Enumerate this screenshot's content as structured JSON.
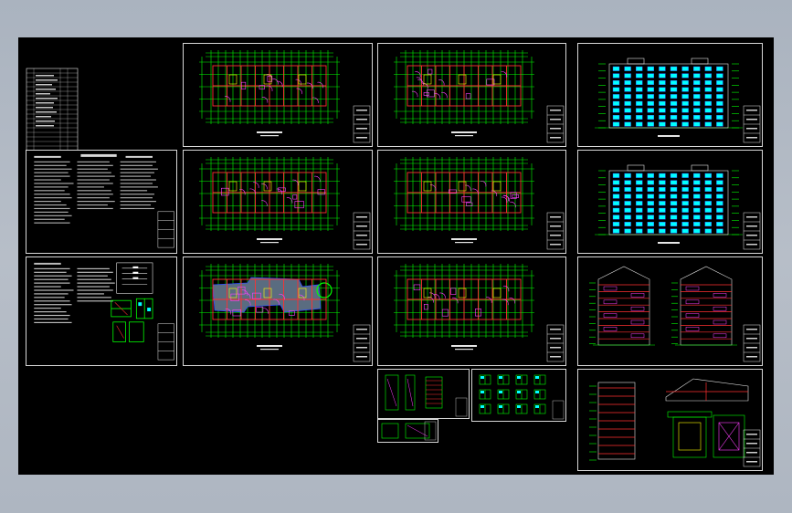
{
  "app": {
    "title": ""
  },
  "colors": {
    "background": "#b3bbc6",
    "canvas": "#000000",
    "border": "#d8d8d8",
    "line_green": "#00ff00",
    "line_red": "#ff3030",
    "line_magenta": "#ff40ff",
    "line_yellow": "#ffff00",
    "line_cyan": "#00ffff",
    "line_blue": "#3050ff",
    "line_white": "#e6e6e6"
  },
  "sheets": [
    {
      "id": "drawing-index",
      "kind": "table"
    },
    {
      "id": "design-notes-1",
      "kind": "text"
    },
    {
      "id": "design-notes-2",
      "kind": "text-details"
    },
    {
      "id": "floor-plan-1",
      "kind": "plan"
    },
    {
      "id": "floor-plan-2",
      "kind": "plan"
    },
    {
      "id": "floor-plan-3",
      "kind": "plan-filled"
    },
    {
      "id": "floor-plan-4",
      "kind": "plan"
    },
    {
      "id": "floor-plan-5",
      "kind": "plan"
    },
    {
      "id": "floor-plan-6",
      "kind": "plan"
    },
    {
      "id": "elevation-front",
      "kind": "elevation"
    },
    {
      "id": "elevation-back",
      "kind": "elevation"
    },
    {
      "id": "sections",
      "kind": "section"
    },
    {
      "id": "details-large",
      "kind": "details"
    },
    {
      "id": "details-stair",
      "kind": "details-small"
    },
    {
      "id": "details-windows",
      "kind": "details-small"
    },
    {
      "id": "details-small-a",
      "kind": "details-small"
    }
  ]
}
